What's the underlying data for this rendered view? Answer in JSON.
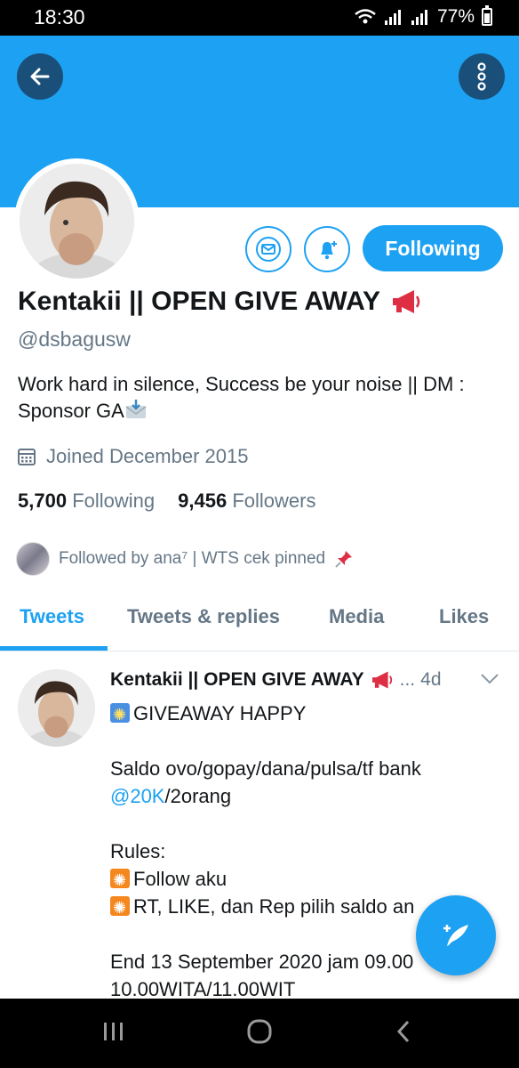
{
  "status_bar": {
    "time": "18:30",
    "battery": "77%"
  },
  "profile": {
    "name": "Kentakii || OPEN GIVE AWAY",
    "handle": "@dsbagusw",
    "bio": "Work hard in silence, Success be your noise || DM : Sponsor GA",
    "joined": "Joined December 2015",
    "following_count": "5,700",
    "following_label": "Following",
    "followers_count": "9,456",
    "followers_label": "Followers",
    "followed_by": "Followed by ana⁷ | WTS cek pinned"
  },
  "actions": {
    "follow_button": "Following"
  },
  "tabs": [
    "Tweets",
    "Tweets & replies",
    "Media",
    "Likes"
  ],
  "tweet": {
    "author": "Kentakii || OPEN GIVE AWAY",
    "more": "...",
    "time": "4d",
    "lines": {
      "l1": "GIVEAWAY HAPPY",
      "l2": "Saldo ovo/gopay/dana/pulsa/tf bank",
      "l3_link": "@20K",
      "l3_rest": "/2orang",
      "l4": "Rules:",
      "l5": "Follow aku",
      "l6": "RT, LIKE, dan Rep pilih saldo an",
      "l7": "End 13 September 2020 jam 09.00",
      "l8": "10.00WITA/11.00WIT"
    }
  },
  "colors": {
    "accent": "#1da1f2",
    "dark_button": "#1a4f7a",
    "muted": "#657786"
  },
  "icons": [
    "back-arrow-icon",
    "more-vertical-icon",
    "mail-icon",
    "bell-plus-icon",
    "megaphone-icon",
    "calendar-icon",
    "envelope-emoji-icon",
    "pin-icon",
    "chevron-down-icon",
    "compose-feather-icon",
    "recents-icon",
    "home-icon",
    "back-icon"
  ]
}
